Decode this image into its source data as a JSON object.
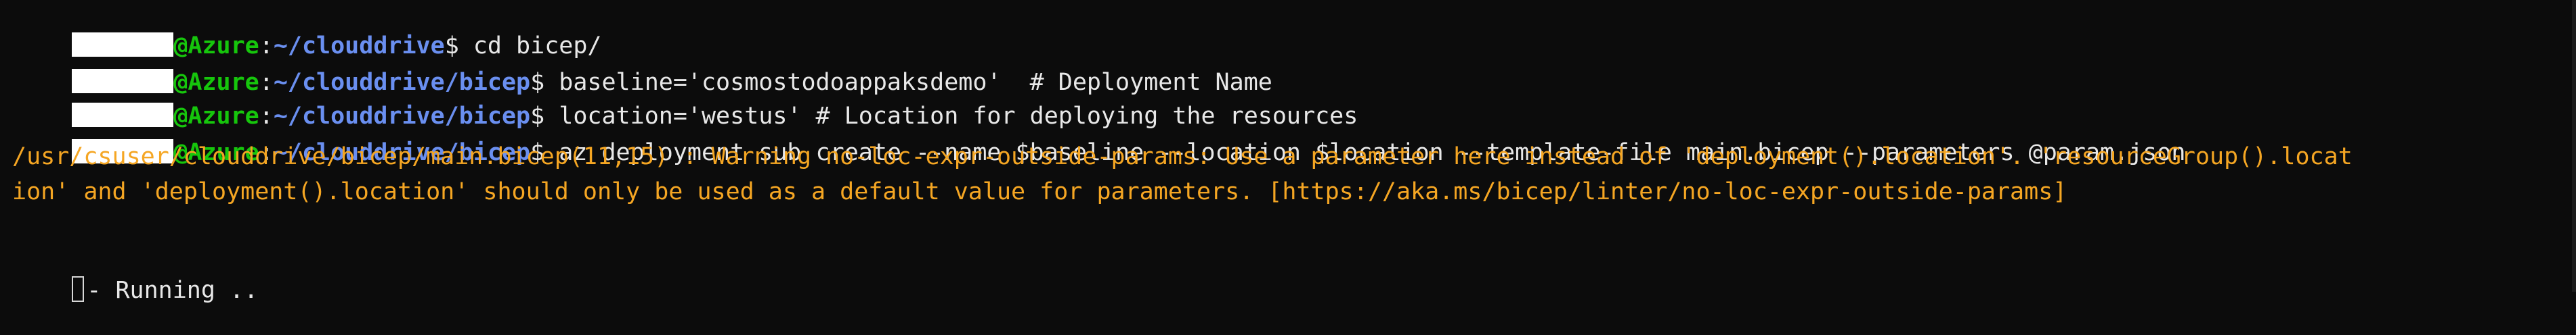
{
  "prompts": [
    {
      "host": "@Azure",
      "path": "~/clouddrive",
      "dollar": "$",
      "command": " cd bicep/"
    },
    {
      "host": "@Azure",
      "path": "~/clouddrive/bicep",
      "dollar": "$",
      "command": " baseline='cosmostodoappaksdemo'  # Deployment Name"
    },
    {
      "host": "@Azure",
      "path": "~/clouddrive/bicep",
      "dollar": "$",
      "command": " location='westus' # Location for deploying the resources"
    },
    {
      "host": "@Azure",
      "path": "~/clouddrive/bicep",
      "dollar": "$",
      "command": " az deployment sub create --name $baseline --location $location --template-file main.bicep --parameters @param.json"
    }
  ],
  "separator": ":",
  "warning_lines": [
    "/usr/csuser/clouddrive/bicep/main.bicep(11,15) : Warning no-loc-expr-outside-params: Use a parameter here instead of 'deployment().location'. 'resourceGroup().locat",
    "ion' and 'deployment().location' should only be used as a default value for parameters. [https://aka.ms/bicep/linter/no-loc-expr-outside-params]"
  ],
  "status_line": "- Running ..",
  "colors": {
    "background": "#0c0c0c",
    "host": "#16c60c",
    "path": "#6a8ff0",
    "text": "#e8e8e8",
    "warning": "#f5a623"
  }
}
